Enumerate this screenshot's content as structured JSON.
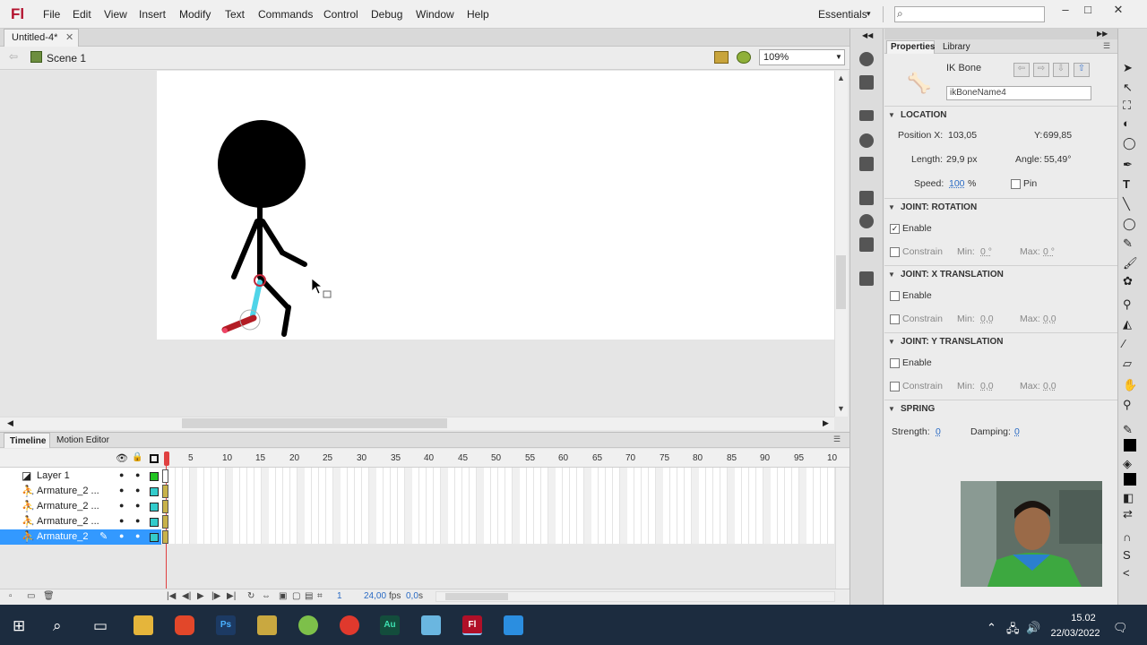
{
  "app": {
    "logo": "Fl"
  },
  "menu": [
    "File",
    "Edit",
    "View",
    "Insert",
    "Modify",
    "Text",
    "Commands",
    "Control",
    "Debug",
    "Window",
    "Help"
  ],
  "workspace": {
    "label": "Essentials"
  },
  "document": {
    "tab": "Untitled-4*",
    "scene": "Scene 1",
    "zoom": "109%"
  },
  "timeline": {
    "tab": "Timeline",
    "motion_tab": "Motion Editor",
    "ticks": [
      "1",
      "5",
      "10",
      "15",
      "20",
      "25",
      "30",
      "35",
      "40",
      "45",
      "50",
      "55",
      "60",
      "65",
      "70",
      "75",
      "80",
      "85",
      "90",
      "95",
      "10"
    ],
    "layers": [
      {
        "name": "Layer 1",
        "color": "#22c422"
      },
      {
        "name": "Armature_2 ...",
        "color": "#33cccc"
      },
      {
        "name": "Armature_2 ...",
        "color": "#33cccc"
      },
      {
        "name": "Armature_2 ...",
        "color": "#33cccc"
      },
      {
        "name": "Armature_2",
        "color": "#33cccc",
        "selected": true
      }
    ],
    "current_frame": "1",
    "fps": "24,00",
    "fps_unit": "fps",
    "elapsed": "0,0",
    "elapsed_unit": "s"
  },
  "properties": {
    "tab": "Properties",
    "library_tab": "Library",
    "type": "IK Bone",
    "name": "ikBoneName4",
    "location": {
      "header": "LOCATION",
      "pos_x_label": "Position X:",
      "pos_x": "103,05",
      "pos_y_label": "Y:",
      "pos_y": "699,85",
      "length_label": "Length:",
      "length": "29,9 px",
      "angle_label": "Angle:",
      "angle": "55,49°",
      "speed_label": "Speed:",
      "speed": "100",
      "speed_unit": "%",
      "pin_label": "Pin"
    },
    "rotation": {
      "header": "JOINT: ROTATION",
      "enable": "Enable",
      "enabled": true,
      "constrain": "Constrain",
      "min_label": "Min:",
      "min": "0 °",
      "max_label": "Max:",
      "max": "0 °"
    },
    "x_translation": {
      "header": "JOINT: X TRANSLATION",
      "enable": "Enable",
      "constrain": "Constrain",
      "min_label": "Min:",
      "min": "0,0",
      "max_label": "Max:",
      "max": "0,0"
    },
    "y_translation": {
      "header": "JOINT: Y TRANSLATION",
      "enable": "Enable",
      "constrain": "Constrain",
      "min_label": "Min:",
      "min": "0,0",
      "max_label": "Max:",
      "max": "0,0"
    },
    "spring": {
      "header": "SPRING",
      "strength_label": "Strength:",
      "strength": "0",
      "damping_label": "Damping:",
      "damping": "0"
    }
  },
  "taskbar": {
    "time": "15.02",
    "date": "22/03/2022"
  }
}
